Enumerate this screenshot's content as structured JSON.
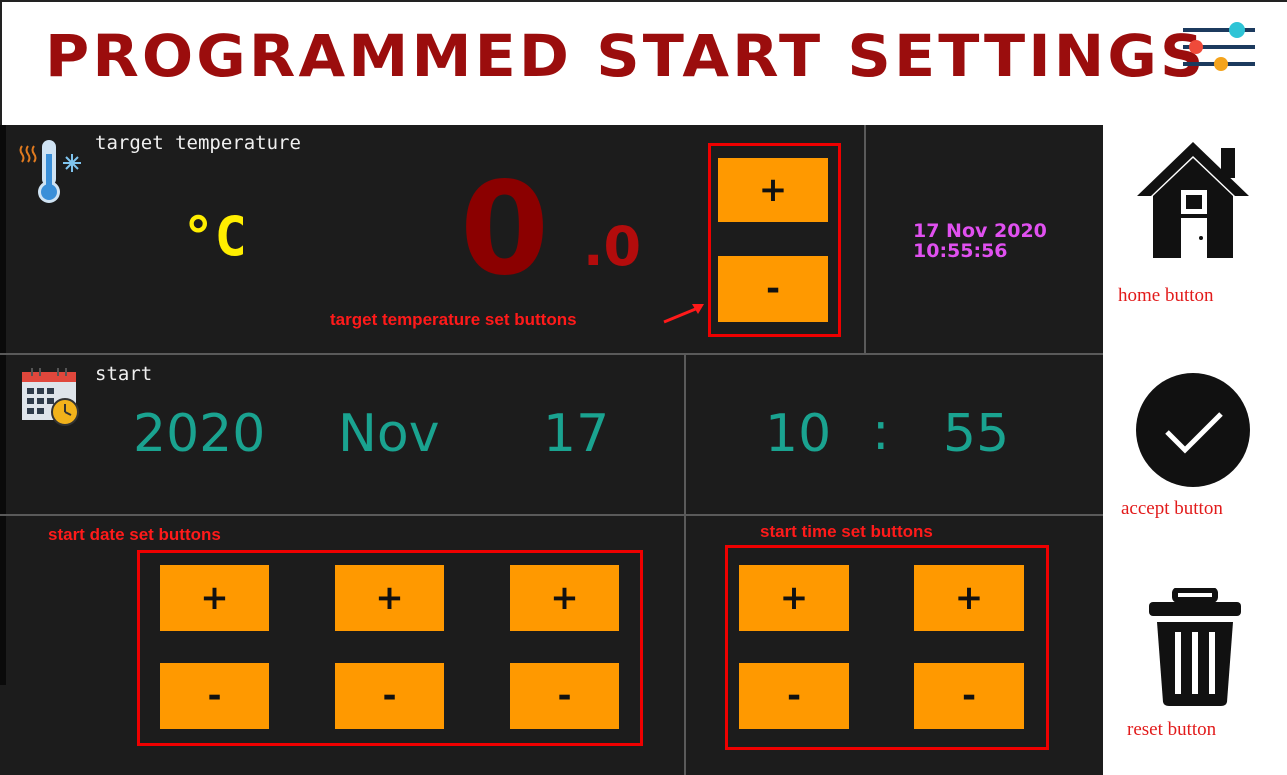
{
  "header": {
    "title": "PROGRAMMED START SETTINGS",
    "settings_icon": "sliders-icon"
  },
  "temperature": {
    "label": "target temperature",
    "unit": "°C",
    "integer_value": "0",
    "decimal_value": ".0",
    "plus_label": "+",
    "minus_label": "-",
    "annotation": "target temperature set buttons",
    "icon": "thermometer-icon"
  },
  "clock": {
    "date": "17 Nov 2020",
    "time": "10:55:56"
  },
  "start": {
    "label": "start",
    "icon": "calendar-clock-icon",
    "year": "2020",
    "month": "Nov",
    "day": "17",
    "hour": "10",
    "separator": ":",
    "minute": "55"
  },
  "date_buttons": {
    "annotation": "start date set buttons",
    "plus_label": "+",
    "minus_label": "-"
  },
  "time_buttons": {
    "annotation": "start time set buttons",
    "plus_label": "+",
    "minus_label": "-"
  },
  "sidebar": {
    "home_caption": "home button",
    "accept_caption": "accept button",
    "reset_caption": "reset button",
    "home_icon": "home-icon",
    "accept_icon": "checkmark-circle-icon",
    "reset_icon": "trash-icon"
  },
  "colors": {
    "title": "#9b0d0d",
    "panel": "#1c1c1c",
    "button": "#ff9900",
    "temperature_digits": "#8b0000",
    "unit": "#ffee00",
    "teal_digits": "#1aa390",
    "clock": "#e050f0",
    "annotation": "#ff1a1a"
  }
}
